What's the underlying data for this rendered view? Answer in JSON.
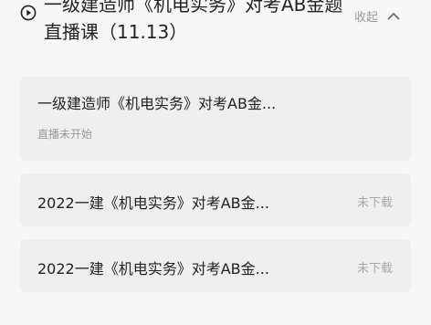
{
  "section": {
    "title": "一级建造师《机电实务》对考AB金题直播课（11.13）",
    "collapse_label": "收起",
    "play_icon": "play-circle-icon",
    "collapse_icon": "chevron-up-icon"
  },
  "lessons": [
    {
      "title": "一级建造师《机电实务》对考AB金...",
      "status": "直播未开始"
    },
    {
      "title": "2022一建《机电实务》对考AB金...",
      "status": "未下载"
    },
    {
      "title": "2022一建《机电实务》对考AB金...",
      "status": "未下载"
    }
  ],
  "colors": {
    "background": "#f7f7f7",
    "card": "#efefef",
    "text": "#222222",
    "muted": "#9a9a9a"
  }
}
